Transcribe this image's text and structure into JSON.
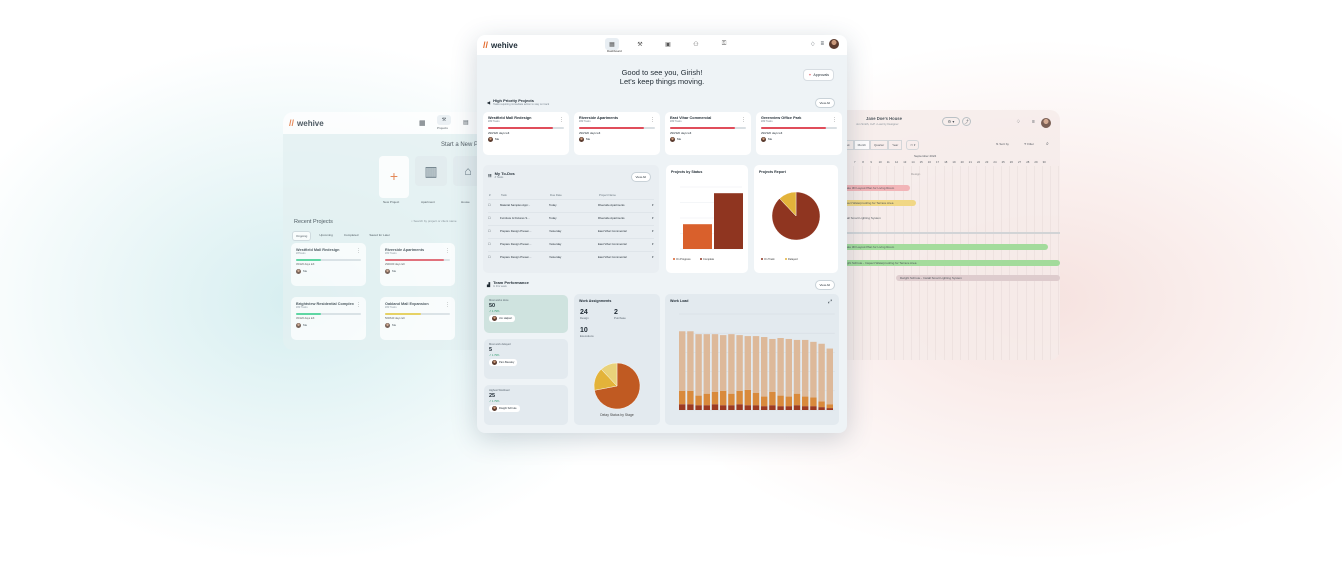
{
  "brand": {
    "name": "wehive",
    "accent": "#e26a2c"
  },
  "left": {
    "nav_label": "Projects",
    "start_title": "Start a New P",
    "tiles": [
      "New Project",
      "Apartment",
      "House"
    ],
    "recent_title": "Recent Projects",
    "search_placeholder": "Search by project or client name",
    "tabs": [
      "Ongoing",
      "Upcoming",
      "Completed",
      "Saved for Later"
    ],
    "cards": [
      {
        "title": "Westfield Mall Redesign",
        "sub": "##Tasks",
        "days": "45/120 days left",
        "owner": "Me",
        "progress": 0.38,
        "color": "#3ccf8e"
      },
      {
        "title": "Riverside Apartments",
        "sub": "### Tasks",
        "days": "290/320 days left",
        "owner": "Me",
        "progress": 0.9,
        "color": "#e04d5b"
      },
      {
        "title": "Brightview Residential Complex",
        "sub": "### Tasks",
        "days": "45/120 days left",
        "owner": "Me",
        "progress": 0.38,
        "color": "#3ccf8e"
      },
      {
        "title": "Oakland Mall Expansion",
        "sub": "### Tasks",
        "days": "560/640 days left",
        "owner": "Me",
        "progress": 0.55,
        "color": "#e8c93d"
      }
    ]
  },
  "main": {
    "nav_label": "Dashboard",
    "greeting_line1": "Good to see you, Girish!",
    "greeting_line2": "Let's keep things moving.",
    "approvals_label": "Approvals",
    "priority": {
      "title": "High Priority Projects",
      "sub": "Tasks requiring immediate action to stay on track",
      "view_all": "View All",
      "cards": [
        {
          "title": "Westfield Mall Redesign",
          "sub": "### Tasks",
          "days": "290/320 days left",
          "owner": "Me",
          "progress": 0.85
        },
        {
          "title": "Riverside Apartments",
          "sub": "### Tasks",
          "days": "290/320 days left",
          "owner": "Me",
          "progress": 0.85
        },
        {
          "title": "East Vihar Commercial",
          "sub": "### Tasks",
          "days": "290/320 days left",
          "owner": "Me",
          "progress": 0.85
        },
        {
          "title": "Greenview Office Park",
          "sub": "### Tasks",
          "days": "290/320 days left",
          "owner": "Me",
          "progress": 0.85
        }
      ]
    },
    "todos": {
      "title": "My To-Dos",
      "sub": "# Tasks",
      "view_all": "View All",
      "headers": [
        "#",
        "Task",
        "Due Date",
        "Project Name"
      ],
      "rows": [
        {
          "task": "Material Samples Appr...",
          "due": "Today",
          "project": "Riverside Apartments"
        },
        {
          "task": "Furniture & Fixtures S...",
          "due": "Today",
          "project": "Riverside Apartments"
        },
        {
          "task": "Prepare Design Presen...",
          "due": "Yesterday",
          "project": "East Vihar Commercial"
        },
        {
          "task": "Prepare Design Presen...",
          "due": "Yesterday",
          "project": "East Vihar Commercial"
        },
        {
          "task": "Prepare Design Presen...",
          "due": "Yesterday",
          "project": "East Vihar Commercial"
        }
      ]
    },
    "status_title": "Projects by Status",
    "report_title": "Projects Report",
    "team": {
      "title": "Team Performance",
      "sub": "In this week",
      "view_all": "View All",
      "kpis": [
        {
          "label": "Most works done",
          "value": "50",
          "trend": "1.79%",
          "person": "Jim Halpert"
        },
        {
          "label": "Most work delayed",
          "value": "5",
          "trend": "1.79%",
          "person": "Pam Beesley"
        },
        {
          "label": "Highest Workload",
          "value": "25",
          "trend": "1.79%",
          "person": "Dwight Schrute"
        }
      ],
      "assign_title": "Work Assignments",
      "assign": [
        {
          "value": "24",
          "label": "Design"
        },
        {
          "value": "2",
          "label": "Purchase"
        },
        {
          "value": "10",
          "label": "Executions"
        }
      ],
      "delay_caption": "Delay Status by Stage",
      "workload_title": "Work Load"
    }
  },
  "right": {
    "title": "Jane Doe's House",
    "sub": "Jon Smith, 3+P • Last by Designer",
    "views": [
      "Week",
      "Month",
      "Quarter",
      "Year"
    ],
    "sort_label": "Sort by",
    "filter_label": "Filter",
    "month": "September 2024",
    "days": [
      "7",
      "8",
      "9",
      "10",
      "11",
      "12",
      "13",
      "14",
      "15",
      "16",
      "17",
      "18",
      "19",
      "20",
      "21",
      "22",
      "23",
      "24",
      "25",
      "26",
      "27",
      "28",
      "29",
      "30"
    ],
    "group": "Design",
    "items": [
      "Create 3D Layout Plan for Living Room",
      "Inspect Waterproofing for Terrace Area",
      "Install Smart Lighting System"
    ],
    "bars": [
      {
        "label": "Create 3D Layout Plan for Living Room",
        "color": "#8fd98a"
      },
      {
        "label": "Dwight Schrute - Inspect Waterproofing for Terrace Area",
        "color": "#8fd98a"
      },
      {
        "label": "Dwight Schrute - Install Smart Lighting System",
        "color": "#d9c6c9"
      }
    ]
  },
  "chart_data": [
    {
      "type": "bar",
      "title": "Projects by Status",
      "categories": [
        "On Progress",
        "Complete"
      ],
      "values": [
        40,
        90
      ],
      "colors": [
        "#d9602c",
        "#8f3520"
      ],
      "legend": "bottom"
    },
    {
      "type": "pie",
      "title": "Projects Report",
      "labels": [
        "On Track",
        "Delayed"
      ],
      "values": [
        88,
        12
      ],
      "colors": [
        "#8f3520",
        "#e3b33a"
      ],
      "legend": "bottom"
    },
    {
      "type": "pie",
      "title": "Delay Status by Stage",
      "values": [
        72,
        16,
        12
      ],
      "colors": [
        "#c05a22",
        "#e3b33a",
        "#e9d27a"
      ]
    },
    {
      "type": "bar",
      "title": "Work Load",
      "stacked": true,
      "series": [
        {
          "values": [
            6,
            6,
            5,
            5,
            6,
            5,
            5,
            6,
            5,
            5,
            4,
            5,
            4,
            4,
            5,
            4,
            4,
            3,
            2
          ]
        },
        {
          "values": [
            14,
            14,
            10,
            12,
            13,
            15,
            12,
            14,
            16,
            13,
            10,
            14,
            11,
            10,
            12,
            10,
            9,
            6,
            4
          ]
        },
        {
          "values": [
            62,
            62,
            64,
            62,
            60,
            58,
            62,
            58,
            56,
            59,
            62,
            55,
            60,
            60,
            56,
            59,
            58,
            60,
            58
          ]
        }
      ],
      "colors": [
        "#9c3a22",
        "#d98a3c",
        "#ddb99a"
      ]
    }
  ]
}
